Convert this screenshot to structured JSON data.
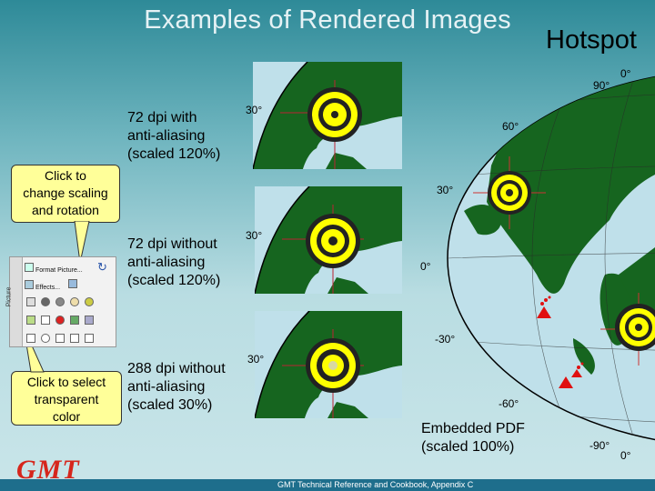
{
  "title": "Examples of Rendered Images",
  "hotspot_label": "Hotspot",
  "examples": [
    {
      "line1": "72 dpi with",
      "line2": "anti-aliasing",
      "line3": "(scaled 120%)",
      "tick": "30°"
    },
    {
      "line1": "72 dpi without",
      "line2": "anti-aliasing",
      "line3": "(scaled 120%)",
      "tick": "30°"
    },
    {
      "line1": "288 dpi without",
      "line2": "anti-aliasing",
      "line3": "(scaled 30%)",
      "tick": "30°"
    }
  ],
  "callout_top": {
    "line1": "Click to",
    "line2": "change scaling",
    "line3": "and rotation"
  },
  "callout_bottom": {
    "line1": "Click to select",
    "line2": "transparent",
    "line3": "color"
  },
  "panel": {
    "format_label": "Format Picture...",
    "effects_label": "Effects...",
    "side_label": "Picture"
  },
  "embedded": {
    "line1": "Embedded PDF",
    "line2": "(scaled 100%)"
  },
  "map_ticks": {
    "t0top": "0°",
    "t90top": "90°",
    "t60": "60°",
    "t30": "30°",
    "t0": "0°",
    "tm30": "-30°",
    "tm60": "-60°",
    "tm90": "-90°",
    "t0bot": "0°"
  },
  "logo": "GMT",
  "footer": "GMT Technical Reference and Cookbook, Appendix C",
  "colors": {
    "ocean": "#bfe0ea",
    "land": "#16651f",
    "target_yellow": "#ffff00",
    "hotspot_red": "#e01010"
  }
}
